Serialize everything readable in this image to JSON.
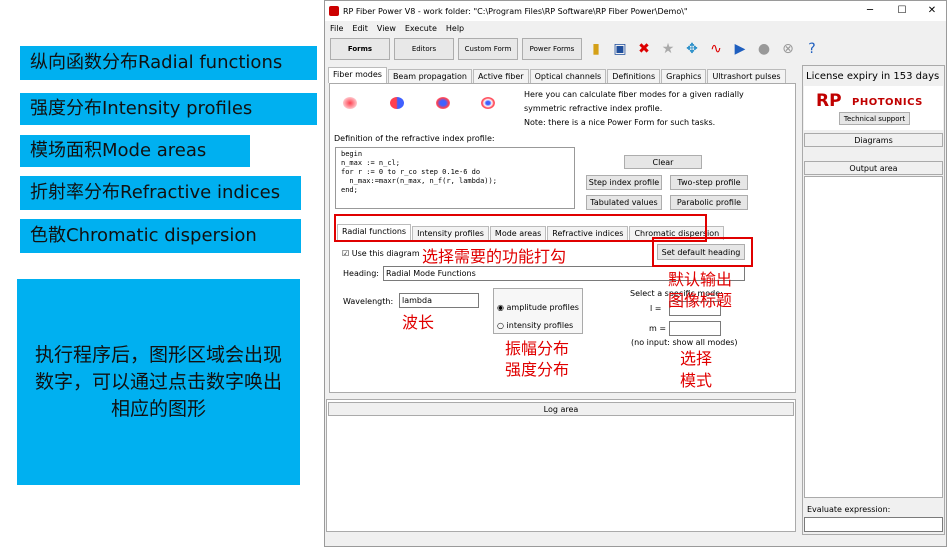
{
  "annotations": {
    "radial": "纵向函数分布Radial functions",
    "intensity": "强度分布Intensity profiles",
    "mode_areas": "模场面积Mode areas",
    "refractive": "折射率分布Refractive indices",
    "chromatic": "色散Chromatic dispersion",
    "note": "执行程序后，图形区域会出现数字，可以通过点击数字唤出相应的图形",
    "select_func": "选择需要的功能打勾",
    "default_heading_1": "默认输出",
    "default_heading_2": "图像标题",
    "wavelength_note": "波长",
    "amp_int_1": "振幅分布",
    "amp_int_2": "强度分布",
    "select_mode_1": "选择",
    "select_mode_2": "模式"
  },
  "window": {
    "title": "RP Fiber Power V8 - work folder: \"C:\\Program Files\\RP Software\\RP Fiber Power\\Demo\\\"",
    "minimize": "─",
    "maximize": "☐",
    "close": "✕"
  },
  "menu": [
    "File",
    "Edit",
    "View",
    "Execute",
    "Help"
  ],
  "toolbar": {
    "forms": "Forms",
    "editors": "Editors",
    "custom_form": "Custom Form",
    "power_forms": "Power Forms"
  },
  "main_tabs": [
    "Fiber modes",
    "Beam propagation",
    "Active fiber",
    "Optical channels",
    "Definitions",
    "Graphics",
    "Ultrashort pulses"
  ],
  "fiber_modes": {
    "desc1": "Here you can calculate fiber modes for a given radially",
    "desc2": "symmetric refractive index profile.",
    "desc3": "Note: there is a nice Power Form for such tasks.",
    "def_label": "Definition of the refractive index profile:",
    "code": [
      "begin",
      "n_max := n_cl;",
      "for r := 0 to r_co step 0.1e-6 do",
      "  n_max:=maxr(n_max, n_f(r, lambda));",
      "end;"
    ],
    "clear": "Clear",
    "step_index": "Step index profile",
    "two_step": "Two-step profile",
    "tabulated": "Tabulated values",
    "parabolic": "Parabolic profile"
  },
  "sub_tabs": [
    "Radial functions",
    "Intensity profiles",
    "Mode areas",
    "Refractive indices",
    "Chromatic dispersion"
  ],
  "radial": {
    "use_diagram": "Use this diagram",
    "set_default_heading": "Set default heading",
    "heading_label": "Heading:",
    "heading_value": "Radial Mode Functions",
    "wavelength_label": "Wavelength:",
    "wavelength_value": "lambda",
    "amplitude": "amplitude profiles",
    "intensity": "intensity profiles",
    "select_mode": "Select a specific mode:",
    "l_label": "l =",
    "m_label": "m =",
    "no_input": "(no input: show all modes)"
  },
  "log_area": "Log area",
  "side": {
    "license": "License expiry in 153 days",
    "logo_rp": "RP",
    "logo_photonics": "PHOTONICS",
    "tech_support": "Technical support",
    "diagrams": "Diagrams",
    "output_area": "Output area",
    "evaluate": "Evaluate expression:"
  },
  "colors": {
    "accent": "#00b0f0",
    "annotation_red": "#e00000",
    "logo_red": "#c00000",
    "logo_blue": "#1f3a93"
  }
}
